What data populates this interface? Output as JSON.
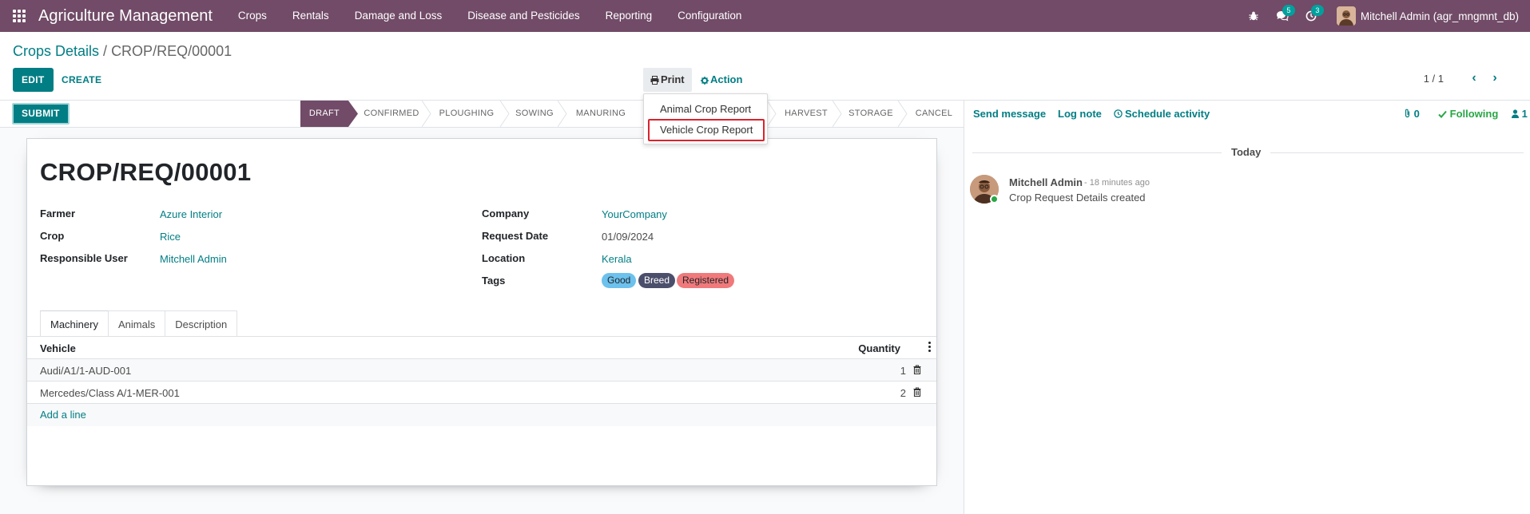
{
  "app": {
    "title": "Agriculture Management",
    "menu": [
      "Crops",
      "Rentals",
      "Damage and Loss",
      "Disease and Pesticides",
      "Reporting",
      "Configuration"
    ],
    "systray": {
      "messages_count": "5",
      "activities_count": "3"
    },
    "user": "Mitchell Admin (agr_mngmnt_db)"
  },
  "breadcrumb": {
    "parent": "Crops Details",
    "separator": " / ",
    "current": "CROP/REQ/00001"
  },
  "toolbar": {
    "edit_label": "EDIT",
    "create_label": "CREATE",
    "print_label": "Print",
    "action_label": "Action",
    "pager": "1 / 1"
  },
  "print_menu": {
    "items": [
      "Animal Crop Report",
      "Vehicle Crop Report"
    ]
  },
  "statusbar": {
    "submit_label": "SUBMIT",
    "stages": [
      "DRAFT",
      "CONFIRMED",
      "PLOUGHING",
      "SOWING",
      "MANURING",
      "HARVEST",
      "STORAGE",
      "CANCEL"
    ],
    "active_stage": "DRAFT"
  },
  "record": {
    "title": "CROP/REQ/00001",
    "left_fields": [
      {
        "label": "Farmer",
        "value": "Azure Interior"
      },
      {
        "label": "Crop",
        "value": "Rice"
      },
      {
        "label": "Responsible User",
        "value": "Mitchell Admin"
      }
    ],
    "right_fields": [
      {
        "label": "Company",
        "value": "YourCompany"
      },
      {
        "label": "Request Date",
        "value": "01/09/2024"
      },
      {
        "label": "Location",
        "value": "Kerala"
      },
      {
        "label": "Tags",
        "value": ""
      }
    ],
    "tags": [
      {
        "name": "Good",
        "color": "#6cc1ed",
        "text_color": "#212529"
      },
      {
        "name": "Breed",
        "color": "#4c4f6b",
        "text_color": "#ffffff"
      },
      {
        "name": "Registered",
        "color": "#f0797b",
        "text_color": "#212529"
      }
    ]
  },
  "tabs": [
    "Machinery",
    "Animals",
    "Description"
  ],
  "machinery": {
    "headers": {
      "vehicle": "Vehicle",
      "quantity": "Quantity"
    },
    "rows": [
      {
        "vehicle": "Audi/A1/1-AUD-001",
        "quantity": "1"
      },
      {
        "vehicle": "Mercedes/Class A/1-MER-001",
        "quantity": "2"
      }
    ],
    "add_line": "Add a line"
  },
  "chatter": {
    "send_message": "Send message",
    "log_note": "Log note",
    "schedule_activity": "Schedule activity",
    "attachments": "0",
    "following": "Following",
    "followers": "1",
    "date_label": "Today",
    "message": {
      "author": "Mitchell Admin",
      "time": "- 18 minutes ago",
      "body": "Crop Request Details created"
    }
  },
  "colors": {
    "brand": "#714b67",
    "primary": "#017e84",
    "highlight": "#d9232e"
  }
}
